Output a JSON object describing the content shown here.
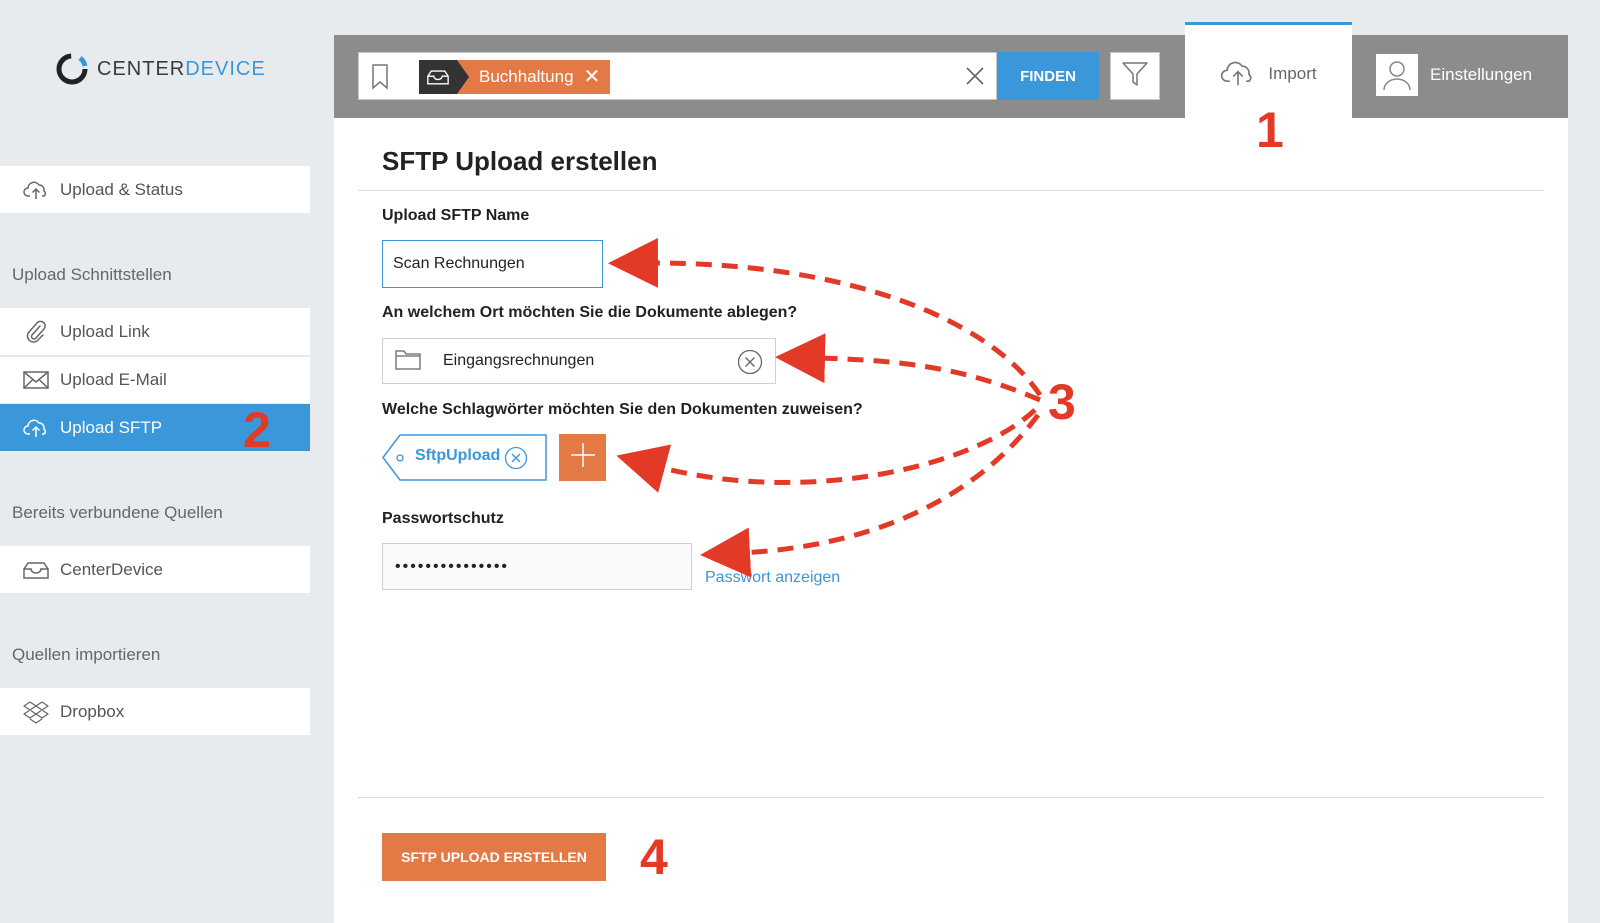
{
  "brand": {
    "name_main": "CENTER",
    "name_accent": "DEVICE"
  },
  "sidebar": {
    "upload_status": "Upload & Status",
    "section_interfaces": "Upload Schnittstellen",
    "items": [
      {
        "label": "Upload Link",
        "icon": "paperclip-icon"
      },
      {
        "label": "Upload E-Mail",
        "icon": "envelope-icon"
      },
      {
        "label": "Upload SFTP",
        "icon": "cloud-upload-icon",
        "active": true
      }
    ],
    "section_connected": "Bereits verbundene Quellen",
    "connected": [
      {
        "label": "CenterDevice",
        "icon": "inbox-icon"
      }
    ],
    "section_import": "Quellen importieren",
    "import": [
      {
        "label": "Dropbox",
        "icon": "dropbox-icon"
      }
    ]
  },
  "header": {
    "search_tag": "Buchhaltung",
    "find_label": "FINDEN",
    "tabs": {
      "import": "Import",
      "settings": "Einstellungen"
    }
  },
  "form": {
    "title": "SFTP Upload erstellen",
    "name_label": "Upload SFTP Name",
    "name_value": "Scan Rechnungen",
    "location_label": "An welchem Ort möchten Sie die Dokumente ablegen?",
    "location_value": "Eingangsrechnungen",
    "keywords_label": "Welche Schlagwörter möchten Sie den Dokumenten zuweisen?",
    "keyword": "SftpUpload",
    "password_label": "Passwortschutz",
    "password_value": "•••••••••••••••",
    "show_password": "Passwort anzeigen",
    "submit": "SFTP UPLOAD ERSTELLEN"
  },
  "annotations": {
    "n1": "1",
    "n2": "2",
    "n3": "3",
    "n4": "4",
    "color": "#e23a26"
  },
  "colors": {
    "accent_blue": "#3a97d9",
    "accent_orange": "#e37a45"
  }
}
